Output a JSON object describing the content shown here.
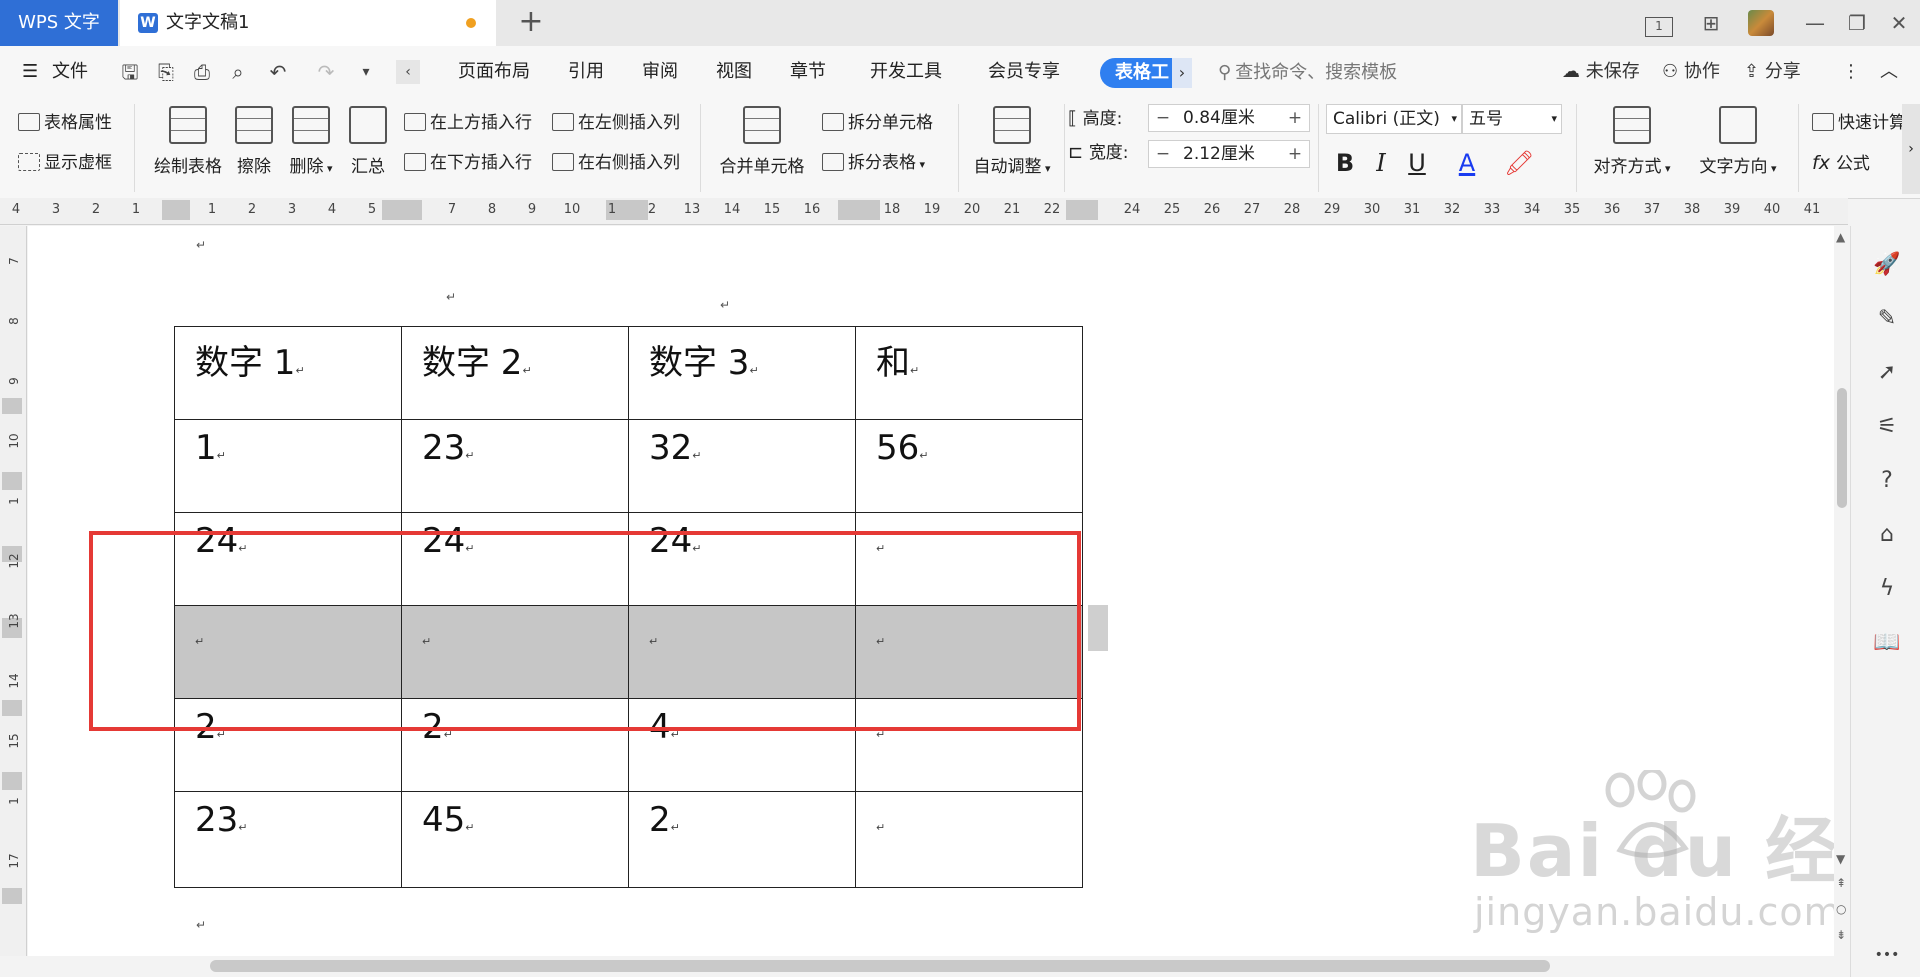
{
  "titlebar": {
    "app_tab": "WPS 文字",
    "doc_tab": "文字文稿1",
    "new_tab_icon": "plus-icon",
    "page_count_badge": "1"
  },
  "menubar": {
    "file": "文件",
    "tabs": [
      "页面布局",
      "引用",
      "审阅",
      "视图",
      "章节",
      "开发工具",
      "会员专享"
    ],
    "active_tab": "表格工",
    "search_placeholder": "查找命令、搜索模板",
    "unsaved": "未保存",
    "collaborate": "协作",
    "share": "分享"
  },
  "ribbon": {
    "table_props": "表格属性",
    "show_gridlines": "显示虚框",
    "draw_table": "绘制表格",
    "erase": "擦除",
    "delete": "删除",
    "summary": "汇总",
    "insert_above": "在上方插入行",
    "insert_below": "在下方插入行",
    "insert_left": "在左侧插入列",
    "insert_right": "在右侧插入列",
    "merge_cells": "合并单元格",
    "split_cells": "拆分单元格",
    "split_table": "拆分表格",
    "auto_fit": "自动调整",
    "height_label": "高度:",
    "height_value": "0.84厘米",
    "width_label": "宽度:",
    "width_value": "2.12厘米",
    "font_name": "Calibri (正文)",
    "font_size": "五号",
    "bold": "B",
    "italic": "I",
    "underline": "U",
    "font_color": "A",
    "align": "对齐方式",
    "text_direction": "文字方向",
    "quick_calc": "快速计算",
    "formula": "公式",
    "fx": "fx",
    "font_color_hex": "#1a3cf0",
    "highlight_color_hex": "#e53935"
  },
  "ruler": {
    "h_ticks_left": [
      "4",
      "3",
      "2",
      "1"
    ],
    "h_ticks_mid": [
      "1",
      "2",
      "3",
      "4",
      "5",
      "",
      "7",
      "8",
      "9",
      "10",
      "1",
      "2",
      "13",
      "14",
      "15",
      "16",
      "",
      "18",
      "19",
      "20",
      "21",
      "22",
      "",
      "24",
      "25",
      "26",
      "27",
      "28",
      "29",
      "30",
      "31",
      "32",
      "33",
      "34",
      "35",
      "36",
      "37",
      "38",
      "39",
      "40",
      "41"
    ],
    "v_ticks": [
      "7",
      "8",
      "9",
      "10",
      "1",
      "12",
      "13",
      "14",
      "15",
      "1",
      "17"
    ]
  },
  "table": {
    "header": [
      "数字 1",
      "数字 2",
      "数字 3",
      "和"
    ],
    "rows": [
      [
        "1",
        "23",
        "32",
        "56"
      ],
      [
        "24",
        "24",
        "24",
        ""
      ],
      [
        "",
        "",
        "",
        ""
      ],
      [
        "2",
        "2",
        "4",
        ""
      ],
      [
        "23",
        "45",
        "2",
        ""
      ]
    ],
    "selected_row_index": 2
  },
  "watermark": {
    "main": "Bai du 经验",
    "sub": "jingyan.baidu.com"
  },
  "sidepanel": {
    "icons": [
      "rocket-icon",
      "pen-icon",
      "cursor-icon",
      "sliders-icon",
      "help-icon",
      "store-icon",
      "lightning-icon",
      "reader-icon"
    ],
    "more": "•••"
  },
  "colors": {
    "accent": "#2f6fd6",
    "selection_box": "#e53935",
    "selected_row": "#c6c6c6"
  }
}
